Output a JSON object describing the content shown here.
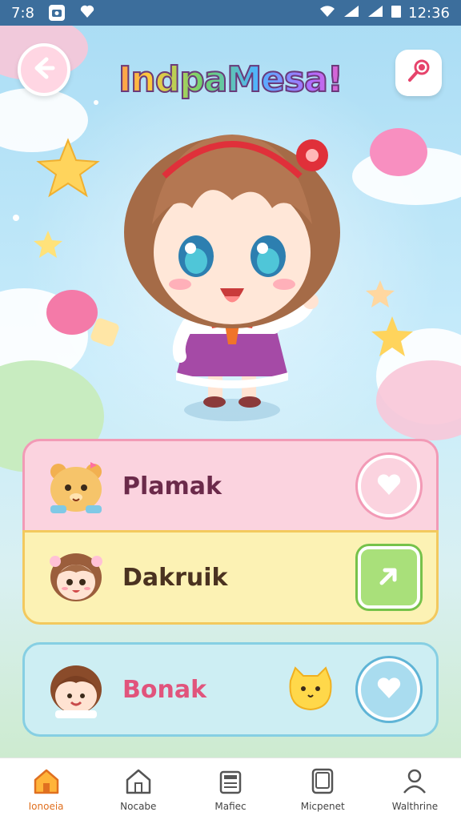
{
  "status_bar": {
    "time_left": "7:8",
    "time_right": "12:36"
  },
  "header": {
    "title": "IndpaMesa!",
    "back_icon": "arrow-left-icon",
    "right_icon": "microphone-icon"
  },
  "cards": [
    {
      "label": "Plamak",
      "avatar_icon": "bear-avatar-icon",
      "action_icon": "heart-icon"
    },
    {
      "label": "Dakruik",
      "avatar_icon": "girl-avatar-icon",
      "action_icon": "arrow-icon"
    },
    {
      "label": "Bonak",
      "avatar_icon": "boy-avatar-icon",
      "action_icon": "heart-icon",
      "badge_icon": "cat-icon"
    }
  ],
  "bottom_nav": [
    {
      "label": "Ionoeia",
      "icon": "home-icon",
      "active": true
    },
    {
      "label": "Nocabe",
      "icon": "house-outline-icon"
    },
    {
      "label": "Mafiec",
      "icon": "printer-icon"
    },
    {
      "label": "Micpenet",
      "icon": "tablet-icon"
    },
    {
      "label": "Walthrine",
      "icon": "user-icon"
    }
  ],
  "colors": {
    "status_bar": "#3c6e9c",
    "card_pink": "#fbd3df",
    "card_yellow": "#fcf2b4",
    "card_blue": "#cdeef3",
    "nav_active": "#e07020"
  }
}
